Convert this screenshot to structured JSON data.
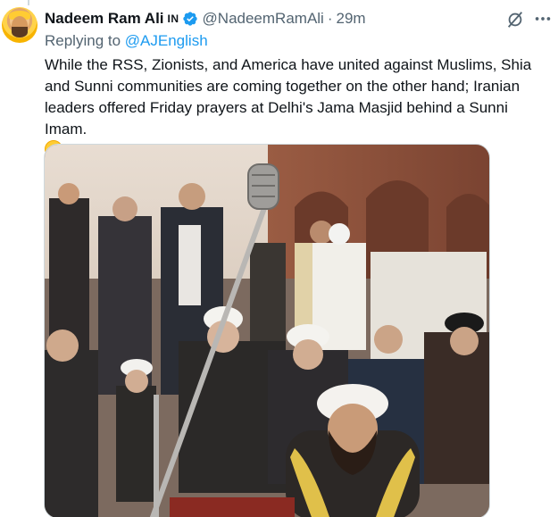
{
  "tweet": {
    "author_name": "Nadeem Ram Ali",
    "country_tag": "IN",
    "handle": "@NadeemRamAli",
    "separator": "·",
    "time": "29m",
    "replying_prefix": "Replying to",
    "replying_to": "@AJEnglish",
    "text": "While the RSS, Zionists, and America have united against Muslims, Shia and Sunni communities are coming together on the other hand; Iranian leaders offered Friday prayers at Delhi's Jama Masjid behind a Sunni Imam.",
    "emoji": "smiling-face-emoji"
  },
  "icons": {
    "verified": "verified-badge-icon",
    "grok": "grok-icon",
    "more": "more-options-icon"
  },
  "colors": {
    "link": "#1d9bf0",
    "secondary_text": "#536471",
    "verified": "#1d9bf0"
  }
}
